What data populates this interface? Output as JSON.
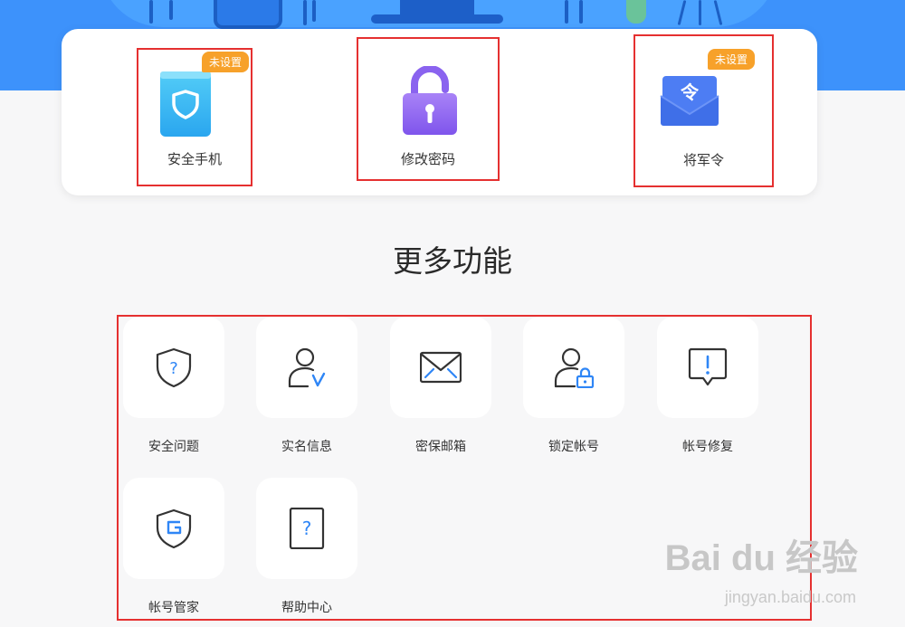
{
  "security_card": {
    "items": [
      {
        "label": "安全手机",
        "badge": "未设置"
      },
      {
        "label": "修改密码"
      },
      {
        "label": "将军令",
        "badge": "未设置"
      }
    ]
  },
  "more_features": {
    "title": "更多功能",
    "items": [
      {
        "label": "安全问题",
        "icon": "shield-question-icon"
      },
      {
        "label": "实名信息",
        "icon": "user-verified-icon"
      },
      {
        "label": "密保邮箱",
        "icon": "envelope-icon"
      },
      {
        "label": "锁定帐号",
        "icon": "user-lock-icon"
      },
      {
        "label": "帐号修复",
        "icon": "alert-message-icon"
      },
      {
        "label": "帐号管家",
        "icon": "shield-g-icon"
      },
      {
        "label": "帮助中心",
        "icon": "help-document-icon"
      }
    ]
  },
  "watermark": {
    "brand": "Bai du 经验",
    "url": "jingyan.baidu.com"
  },
  "colors": {
    "accent_blue": "#3d92fb",
    "badge_orange": "#f7a12a",
    "highlight_red": "#e53030"
  }
}
